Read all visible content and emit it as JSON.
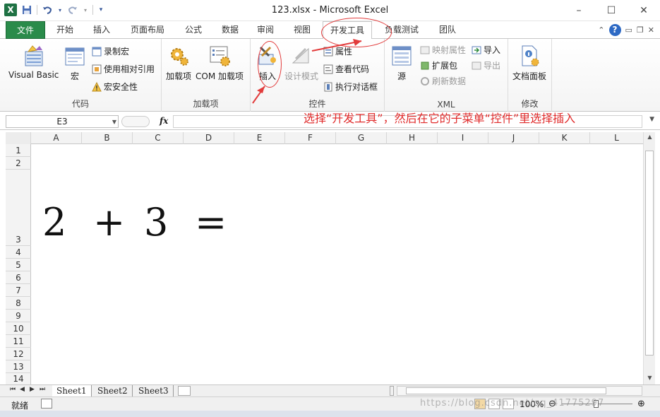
{
  "window": {
    "title": "123.xlsx - Microsoft Excel",
    "controls": {
      "minimize": "–",
      "maximize": "☐",
      "close": "✕"
    }
  },
  "quick_access": {
    "logo": "X"
  },
  "tabs": [
    {
      "label": "文件"
    },
    {
      "label": "开始"
    },
    {
      "label": "插入"
    },
    {
      "label": "页面布局"
    },
    {
      "label": "公式"
    },
    {
      "label": "数据"
    },
    {
      "label": "审阅"
    },
    {
      "label": "视图"
    },
    {
      "label": "开发工具"
    },
    {
      "label": "负载测试"
    },
    {
      "label": "团队"
    }
  ],
  "active_tab": "开发工具",
  "ribbon": {
    "code": {
      "label": "代码",
      "visual_basic": "Visual Basic",
      "macros": "宏",
      "record_macro": "录制宏",
      "relative_ref": "使用相对引用",
      "macro_security": "宏安全性"
    },
    "addins": {
      "label": "加载项",
      "addins": "加载项",
      "com_addins": "COM 加载项"
    },
    "controls": {
      "label": "控件",
      "insert": "插入",
      "design_mode": "设计模式",
      "properties": "属性",
      "view_code": "查看代码",
      "run_dialog": "执行对话框"
    },
    "xml": {
      "label": "XML",
      "source": "源",
      "map_properties": "映射属性",
      "expansion_packs": "扩展包",
      "refresh_data": "刷新数据",
      "import": "导入",
      "export": "导出"
    },
    "modify": {
      "label": "修改",
      "document_panel": "文档面板"
    }
  },
  "formula_bar": {
    "name_box": "E3",
    "fx": "fx",
    "formula": ""
  },
  "annotation": "选择“开发工具”，然后在它的子菜单“控件”里选择插入",
  "columns": [
    "A",
    "B",
    "C",
    "D",
    "E",
    "F",
    "G",
    "H",
    "I",
    "J",
    "K",
    "L"
  ],
  "rows": [
    "1",
    "2",
    "3",
    "4",
    "5",
    "6",
    "7",
    "8",
    "9",
    "10",
    "11",
    "12",
    "13",
    "14"
  ],
  "cells": {
    "A3": "2",
    "B3": "+",
    "C3": "3",
    "D3": "="
  },
  "sheets": [
    "Sheet1",
    "Sheet2",
    "Sheet3"
  ],
  "active_sheet": "Sheet1",
  "status": {
    "ready": "就绪",
    "zoom": "100%"
  },
  "watermark": "https://blog.csdn.net/qq_41775297",
  "colors": {
    "file_tab": "#2a8b4a",
    "annotation": "#e02b2b",
    "ribbon_bg": "#f4f4f4"
  }
}
